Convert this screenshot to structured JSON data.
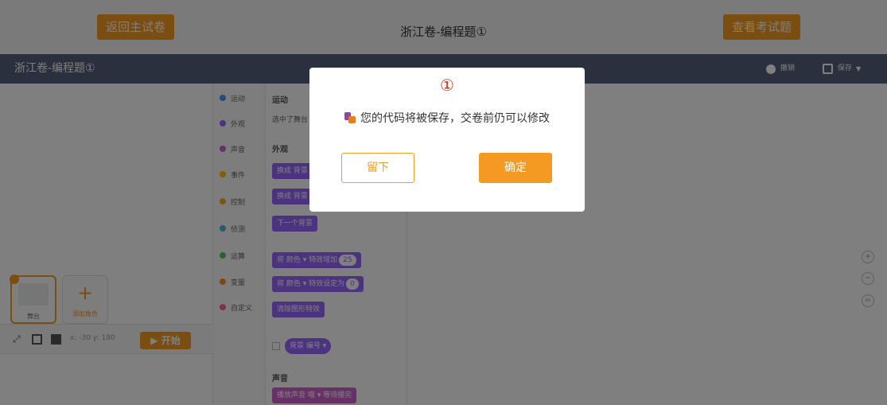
{
  "header": {
    "back_label": "返回主试卷",
    "title": "浙江卷-编程题①",
    "view_label": "查看考试题"
  },
  "project_bar": {
    "title": "浙江卷-编程题①",
    "undo_label": "撤销",
    "save_label": "保存"
  },
  "stage": {
    "coords": "x: -30  y: 180",
    "start_label": "▶ 开始",
    "stage_sprite_label": "舞台",
    "add_sprite_label": "添加角色"
  },
  "categories": [
    {
      "label": "运动",
      "color": "#4c97ff"
    },
    {
      "label": "外观",
      "color": "#9966ff"
    },
    {
      "label": "声音",
      "color": "#cf63cf"
    },
    {
      "label": "事件",
      "color": "#ffbf00"
    },
    {
      "label": "控制",
      "color": "#ffab19"
    },
    {
      "label": "侦测",
      "color": "#5cb1d6"
    },
    {
      "label": "运算",
      "color": "#59c059"
    },
    {
      "label": "变量",
      "color": "#ff8c1a"
    },
    {
      "label": "自定义",
      "color": "#ff6680"
    }
  ],
  "palette": {
    "motion_title": "运动",
    "motion_note": "选中了舞台",
    "looks_title": "外观",
    "block_switch_backdrop_1": "换成  背景",
    "block_switch_backdrop_2": "换成  背景",
    "block_next_backdrop": "下一个背景",
    "block_change_effect": "将  颜色 ▾  特效增加",
    "block_change_effect_value": "25",
    "block_set_effect": "将  颜色 ▾  特效设定为",
    "block_set_effect_value": "0",
    "block_clear_effects": "清除图形特效",
    "block_backdrop_reporter": "背景  编号 ▾",
    "sound_title": "声音",
    "block_play_sound": "播放声音  喵 ▾  等待播完"
  },
  "dialog": {
    "number": "①",
    "message": "您的代码将被保存，交卷前仍可以修改",
    "stay_label": "留下",
    "ok_label": "确定"
  },
  "colors": {
    "accent": "#f49a22",
    "project_bar": "#55607a",
    "dialog_number": "#e4300e"
  }
}
